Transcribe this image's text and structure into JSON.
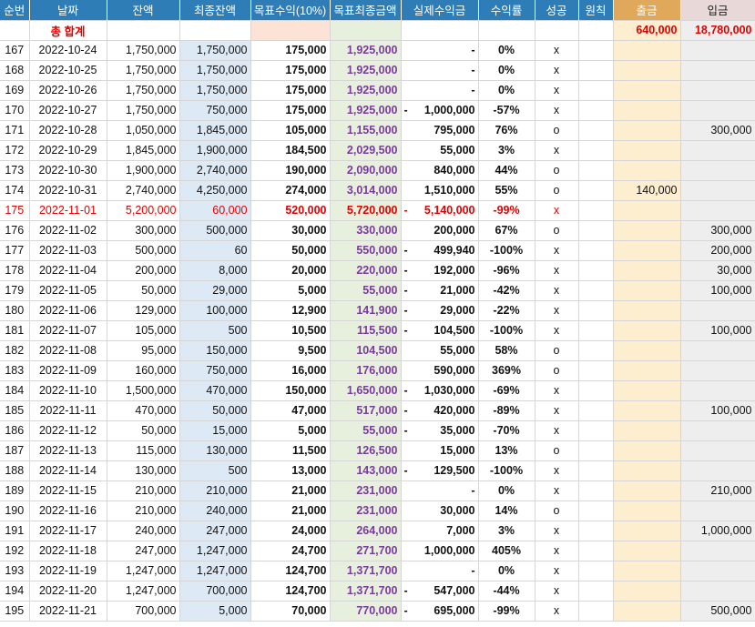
{
  "headers": [
    "순번",
    "날짜",
    "잔액",
    "최종잔액",
    "목표수익(10%)",
    "목표최종금액",
    "실제수익금",
    "수익률",
    "성공",
    "원칙",
    "출금",
    "입금"
  ],
  "total": {
    "label": "총 합계",
    "withdraw": "640,000",
    "deposit": "18,780,000"
  },
  "rows": [
    {
      "no": "167",
      "date": "2022-10-24",
      "bal": "1,750,000",
      "final": "1,750,000",
      "target": "175,000",
      "tfinal": "1,925,000",
      "neg": "",
      "profit": "-",
      "rate": "0%",
      "ok": "x",
      "out": "",
      "in": ""
    },
    {
      "no": "168",
      "date": "2022-10-25",
      "bal": "1,750,000",
      "final": "1,750,000",
      "target": "175,000",
      "tfinal": "1,925,000",
      "neg": "",
      "profit": "-",
      "rate": "0%",
      "ok": "x",
      "out": "",
      "in": ""
    },
    {
      "no": "169",
      "date": "2022-10-26",
      "bal": "1,750,000",
      "final": "1,750,000",
      "target": "175,000",
      "tfinal": "1,925,000",
      "neg": "",
      "profit": "-",
      "rate": "0%",
      "ok": "x",
      "out": "",
      "in": ""
    },
    {
      "no": "170",
      "date": "2022-10-27",
      "bal": "1,750,000",
      "final": "750,000",
      "target": "175,000",
      "tfinal": "1,925,000",
      "neg": "-",
      "profit": "1,000,000",
      "rate": "-57%",
      "ok": "x",
      "out": "",
      "in": ""
    },
    {
      "no": "171",
      "date": "2022-10-28",
      "bal": "1,050,000",
      "final": "1,845,000",
      "target": "105,000",
      "tfinal": "1,155,000",
      "neg": "",
      "profit": "795,000",
      "rate": "76%",
      "ok": "o",
      "out": "",
      "in": "300,000"
    },
    {
      "no": "172",
      "date": "2022-10-29",
      "bal": "1,845,000",
      "final": "1,900,000",
      "target": "184,500",
      "tfinal": "2,029,500",
      "neg": "",
      "profit": "55,000",
      "rate": "3%",
      "ok": "x",
      "out": "",
      "in": ""
    },
    {
      "no": "173",
      "date": "2022-10-30",
      "bal": "1,900,000",
      "final": "2,740,000",
      "target": "190,000",
      "tfinal": "2,090,000",
      "neg": "",
      "profit": "840,000",
      "rate": "44%",
      "ok": "o",
      "out": "",
      "in": ""
    },
    {
      "no": "174",
      "date": "2022-10-31",
      "bal": "2,740,000",
      "final": "4,250,000",
      "target": "274,000",
      "tfinal": "3,014,000",
      "neg": "",
      "profit": "1,510,000",
      "rate": "55%",
      "ok": "o",
      "out": "140,000",
      "in": ""
    },
    {
      "no": "175",
      "date": "2022-11-01",
      "bal": "5,200,000",
      "final": "60,000",
      "target": "520,000",
      "tfinal": "5,720,000",
      "neg": "-",
      "profit": "5,140,000",
      "rate": "-99%",
      "ok": "x",
      "out": "",
      "in": "",
      "red": true
    },
    {
      "no": "176",
      "date": "2022-11-02",
      "bal": "300,000",
      "final": "500,000",
      "target": "30,000",
      "tfinal": "330,000",
      "neg": "",
      "profit": "200,000",
      "rate": "67%",
      "ok": "o",
      "out": "",
      "in": "300,000"
    },
    {
      "no": "177",
      "date": "2022-11-03",
      "bal": "500,000",
      "final": "60",
      "target": "50,000",
      "tfinal": "550,000",
      "neg": "-",
      "profit": "499,940",
      "rate": "-100%",
      "ok": "x",
      "out": "",
      "in": "200,000"
    },
    {
      "no": "178",
      "date": "2022-11-04",
      "bal": "200,000",
      "final": "8,000",
      "target": "20,000",
      "tfinal": "220,000",
      "neg": "-",
      "profit": "192,000",
      "rate": "-96%",
      "ok": "x",
      "out": "",
      "in": "30,000"
    },
    {
      "no": "179",
      "date": "2022-11-05",
      "bal": "50,000",
      "final": "29,000",
      "target": "5,000",
      "tfinal": "55,000",
      "neg": "-",
      "profit": "21,000",
      "rate": "-42%",
      "ok": "x",
      "out": "",
      "in": "100,000"
    },
    {
      "no": "180",
      "date": "2022-11-06",
      "bal": "129,000",
      "final": "100,000",
      "target": "12,900",
      "tfinal": "141,900",
      "neg": "-",
      "profit": "29,000",
      "rate": "-22%",
      "ok": "x",
      "out": "",
      "in": ""
    },
    {
      "no": "181",
      "date": "2022-11-07",
      "bal": "105,000",
      "final": "500",
      "target": "10,500",
      "tfinal": "115,500",
      "neg": "-",
      "profit": "104,500",
      "rate": "-100%",
      "ok": "x",
      "out": "",
      "in": "100,000"
    },
    {
      "no": "182",
      "date": "2022-11-08",
      "bal": "95,000",
      "final": "150,000",
      "target": "9,500",
      "tfinal": "104,500",
      "neg": "",
      "profit": "55,000",
      "rate": "58%",
      "ok": "o",
      "out": "",
      "in": ""
    },
    {
      "no": "183",
      "date": "2022-11-09",
      "bal": "160,000",
      "final": "750,000",
      "target": "16,000",
      "tfinal": "176,000",
      "neg": "",
      "profit": "590,000",
      "rate": "369%",
      "ok": "o",
      "out": "",
      "in": ""
    },
    {
      "no": "184",
      "date": "2022-11-10",
      "bal": "1,500,000",
      "final": "470,000",
      "target": "150,000",
      "tfinal": "1,650,000",
      "neg": "-",
      "profit": "1,030,000",
      "rate": "-69%",
      "ok": "x",
      "out": "",
      "in": ""
    },
    {
      "no": "185",
      "date": "2022-11-11",
      "bal": "470,000",
      "final": "50,000",
      "target": "47,000",
      "tfinal": "517,000",
      "neg": "-",
      "profit": "420,000",
      "rate": "-89%",
      "ok": "x",
      "out": "",
      "in": "100,000"
    },
    {
      "no": "186",
      "date": "2022-11-12",
      "bal": "50,000",
      "final": "15,000",
      "target": "5,000",
      "tfinal": "55,000",
      "neg": "-",
      "profit": "35,000",
      "rate": "-70%",
      "ok": "x",
      "out": "",
      "in": ""
    },
    {
      "no": "187",
      "date": "2022-11-13",
      "bal": "115,000",
      "final": "130,000",
      "target": "11,500",
      "tfinal": "126,500",
      "neg": "",
      "profit": "15,000",
      "rate": "13%",
      "ok": "o",
      "out": "",
      "in": ""
    },
    {
      "no": "188",
      "date": "2022-11-14",
      "bal": "130,000",
      "final": "500",
      "target": "13,000",
      "tfinal": "143,000",
      "neg": "-",
      "profit": "129,500",
      "rate": "-100%",
      "ok": "x",
      "out": "",
      "in": ""
    },
    {
      "no": "189",
      "date": "2022-11-15",
      "bal": "210,000",
      "final": "210,000",
      "target": "21,000",
      "tfinal": "231,000",
      "neg": "",
      "profit": "-",
      "rate": "0%",
      "ok": "x",
      "out": "",
      "in": "210,000"
    },
    {
      "no": "190",
      "date": "2022-11-16",
      "bal": "210,000",
      "final": "240,000",
      "target": "21,000",
      "tfinal": "231,000",
      "neg": "",
      "profit": "30,000",
      "rate": "14%",
      "ok": "o",
      "out": "",
      "in": ""
    },
    {
      "no": "191",
      "date": "2022-11-17",
      "bal": "240,000",
      "final": "247,000",
      "target": "24,000",
      "tfinal": "264,000",
      "neg": "",
      "profit": "7,000",
      "rate": "3%",
      "ok": "x",
      "out": "",
      "in": "1,000,000"
    },
    {
      "no": "192",
      "date": "2022-11-18",
      "bal": "247,000",
      "final": "1,247,000",
      "target": "24,700",
      "tfinal": "271,700",
      "neg": "",
      "profit": "1,000,000",
      "rate": "405%",
      "ok": "x",
      "out": "",
      "in": ""
    },
    {
      "no": "193",
      "date": "2022-11-19",
      "bal": "1,247,000",
      "final": "1,247,000",
      "target": "124,700",
      "tfinal": "1,371,700",
      "neg": "",
      "profit": "-",
      "rate": "0%",
      "ok": "x",
      "out": "",
      "in": ""
    },
    {
      "no": "194",
      "date": "2022-11-20",
      "bal": "1,247,000",
      "final": "700,000",
      "target": "124,700",
      "tfinal": "1,371,700",
      "neg": "-",
      "profit": "547,000",
      "rate": "-44%",
      "ok": "x",
      "out": "",
      "in": ""
    },
    {
      "no": "195",
      "date": "2022-11-21",
      "bal": "700,000",
      "final": "5,000",
      "target": "70,000",
      "tfinal": "770,000",
      "neg": "-",
      "profit": "695,000",
      "rate": "-99%",
      "ok": "x",
      "out": "",
      "in": "500,000"
    }
  ]
}
